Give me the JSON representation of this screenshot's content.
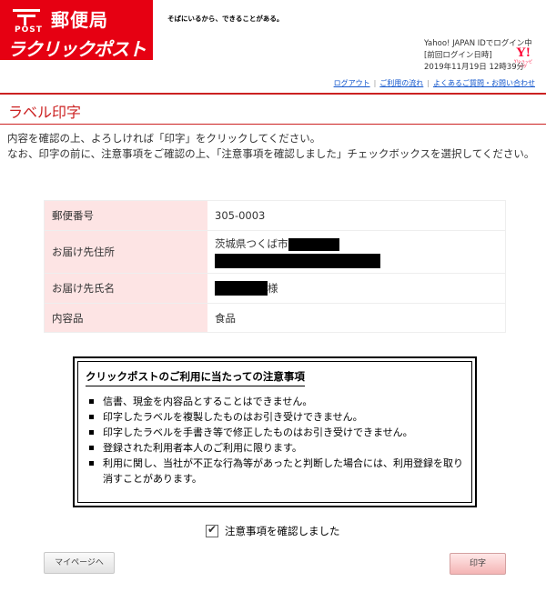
{
  "header": {
    "yubin_title": "郵便局",
    "post_label": "POST",
    "brand": "ラクリックポスト",
    "tagline": "そばにいるから、できることがある。",
    "user": {
      "login_text": "Yahoo! JAPAN IDでログイン中",
      "last_login_label": "[前回ログイン日時]",
      "last_login_value": "2019年11月19日 12時39分"
    },
    "yahoo_mark": "Y!",
    "yahoo_sub": "Y!ショッピング",
    "nav": {
      "logout": "ログアウト",
      "usage_flow": "ご利用の流れ",
      "faq_contact": "よくあるご質問・お問い合わせ"
    }
  },
  "page": {
    "title": "ラベル印字",
    "intro_1": "内容を確認の上、よろしければ「印字」をクリックしてください。",
    "intro_2": "なお、印字の前に、注意事項をご確認の上、「注意事項を確認しました」チェックボックスを選択してください。"
  },
  "confirm": {
    "postal_code_label": "郵便番号",
    "postal_code_value": "305-0003",
    "address_label": "お届け先住所",
    "address_value": "茨城県つくば市",
    "name_label": "お届け先氏名",
    "name_suffix": "様",
    "contents_label": "内容品",
    "contents_value": "食品"
  },
  "notice": {
    "title": "クリックポストのご利用に当たっての注意事項",
    "items": [
      "信書、現金を内容品とすることはできません。",
      "印字したラベルを複製したものはお引き受けできません。",
      "印字したラベルを手書き等で修正したものはお引き受けできません。",
      "登録された利用者本人のご利用に限ります。",
      "利用に関し、当社が不正な行為等があったと判断した場合には、利用登録を取り消すことがあります。"
    ]
  },
  "agree": {
    "label": "注意事項を確認しました",
    "checked": true
  },
  "buttons": {
    "mypage": "マイページへ",
    "print": "印字"
  },
  "colors": {
    "brand_red": "#e60012",
    "title_red": "#cc2222",
    "table_header_bg": "#fde4e4",
    "link_blue": "#1155cc"
  }
}
